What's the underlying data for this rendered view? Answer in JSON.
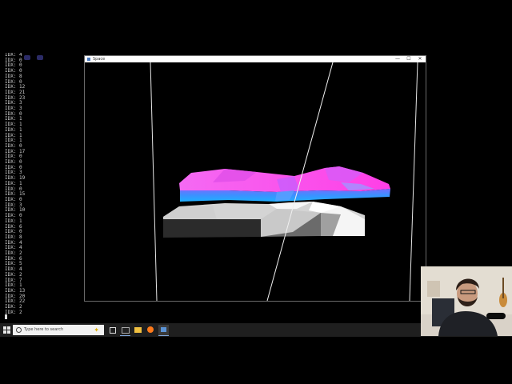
{
  "console": {
    "lines": [
      "IDX: 4",
      "IDX: 0",
      "IDX: 0",
      "IDX: 0",
      "IDX: 8",
      "IDX: 0",
      "IDX: 12",
      "IDX: 21",
      "IDX: 23",
      "IDX: 3",
      "IDX: 3",
      "IDX: 0",
      "IDX: 1",
      "IDX: 1",
      "IDX: 1",
      "IDX: 1",
      "IDX: 1",
      "IDX: 0",
      "IDX: 17",
      "IDX: 0",
      "IDX: 0",
      "IDX: 0",
      "IDX: 3",
      "IDX: 19",
      "IDX: 1",
      "IDX: 0",
      "IDX: 15",
      "IDX: 0",
      "IDX: 3",
      "IDX: 10",
      "IDX: 0",
      "IDX: 1",
      "IDX: 6",
      "IDX: 0",
      "IDX: 8",
      "IDX: 4",
      "IDX: 4",
      "IDX: 2",
      "IDX: 6",
      "IDX: 5",
      "IDX: 4",
      "IDX: 2",
      "IDX: 7",
      "IDX: 1",
      "IDX: 13",
      "IDX: 20",
      "IDX: 22",
      "IDX: 2",
      "IDX: 2"
    ]
  },
  "window": {
    "title": "Space",
    "minimize_glyph": "—",
    "maximize_glyph": "☐",
    "close_glyph": "✕"
  },
  "taskbar": {
    "search_placeholder": "Type here to search"
  },
  "colors": {
    "upper_slab_top": "#ff55f0",
    "upper_slab_side": "#2aa8ff",
    "lower_slab_top": "#d8d8d8",
    "lower_slab_side": "#2a2a2a"
  }
}
